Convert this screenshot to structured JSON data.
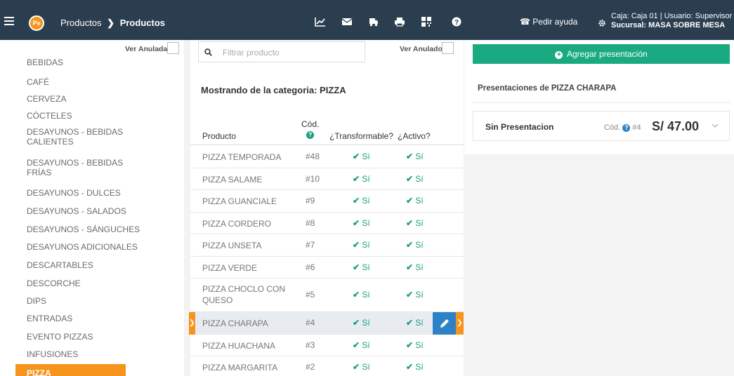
{
  "header": {
    "breadcrumb_parent": "Productos",
    "breadcrumb_current": "Productos",
    "logo_text": "Pe",
    "help_label": "Pedir ayuda",
    "session_line1": "Caja: Caja 01 | Usuario: Supervisor",
    "session_line2": "Sucursal: MASA SOBRE MESA",
    "icons": [
      "chart-icon",
      "mail-icon",
      "truck-icon",
      "printer-icon",
      "qr-icon",
      "help-icon",
      "phone-icon",
      "gear-icon"
    ]
  },
  "sidebar": {
    "ver_anuladas_label": "Ver Anuladas",
    "categories": [
      "BEBIDAS",
      "CAFÉ",
      "CERVEZA",
      "CÓCTELES",
      "DESAYUNOS - BEBIDAS CALIENTES",
      "DESAYUNOS - BEBIDAS FRÍAS",
      "DESAYUNOS - DULCES",
      "DESAYUNOS - SALADOS",
      "DESAYUNOS - SÁNGUCHES",
      "DESAYUNOS ADICIONALES",
      "DESCARTABLES",
      "DESCORCHE",
      "DIPS",
      "ENTRADAS",
      "EVENTO PIZZAS",
      "INFUSIONES",
      "PIZZA"
    ],
    "active_category": "PIZZA"
  },
  "products": {
    "search_placeholder": "Filtrar producto",
    "ver_anulados_label": "Ver Anulados",
    "heading": "Mostrando de la categoria: PIZZA",
    "col_product": "Producto",
    "col_code": "Cód.",
    "col_transformable": "¿Transformable?",
    "col_active": "¿Activo?",
    "rows": [
      {
        "name": "PIZZA TEMPORADA",
        "code": "#48",
        "transformable": "Sí",
        "active": "Sí"
      },
      {
        "name": "PIZZA SALAME",
        "code": "#10",
        "transformable": "Sí",
        "active": "Sí"
      },
      {
        "name": "PIZZA GUANCIALE",
        "code": "#9",
        "transformable": "Sí",
        "active": "Sí"
      },
      {
        "name": "PIZZA CORDERO",
        "code": "#8",
        "transformable": "Sí",
        "active": "Sí"
      },
      {
        "name": "PIZZA UNSETA",
        "code": "#7",
        "transformable": "Sí",
        "active": "Sí"
      },
      {
        "name": "PIZZA VERDE",
        "code": "#6",
        "transformable": "Sí",
        "active": "Sí"
      },
      {
        "name": "PIZZA CHOCLO CON QUESO",
        "code": "#5",
        "transformable": "Sí",
        "active": "Sí"
      },
      {
        "name": "PIZZA CHARAPA",
        "code": "#4",
        "transformable": "Sí",
        "active": "Sí"
      },
      {
        "name": "PIZZA HUACHANA",
        "code": "#3",
        "transformable": "Sí",
        "active": "Sí"
      },
      {
        "name": "PIZZA MARGARITA",
        "code": "#2",
        "transformable": "Sí",
        "active": "Sí"
      }
    ],
    "selected_index": 7
  },
  "presentations": {
    "add_button_label": "Agregar presentación",
    "title": "Presentaciones de PIZZA CHARAPA",
    "items": [
      {
        "name": "Sin Presentacion",
        "code_label": "Cód.",
        "code": "#4",
        "price": "S/ 47.00"
      }
    ]
  },
  "colors": {
    "topbar": "#2b3e50",
    "accent_orange": "#f7941d",
    "accent_green": "#1aaa82",
    "edit_blue": "#2d82c7"
  }
}
